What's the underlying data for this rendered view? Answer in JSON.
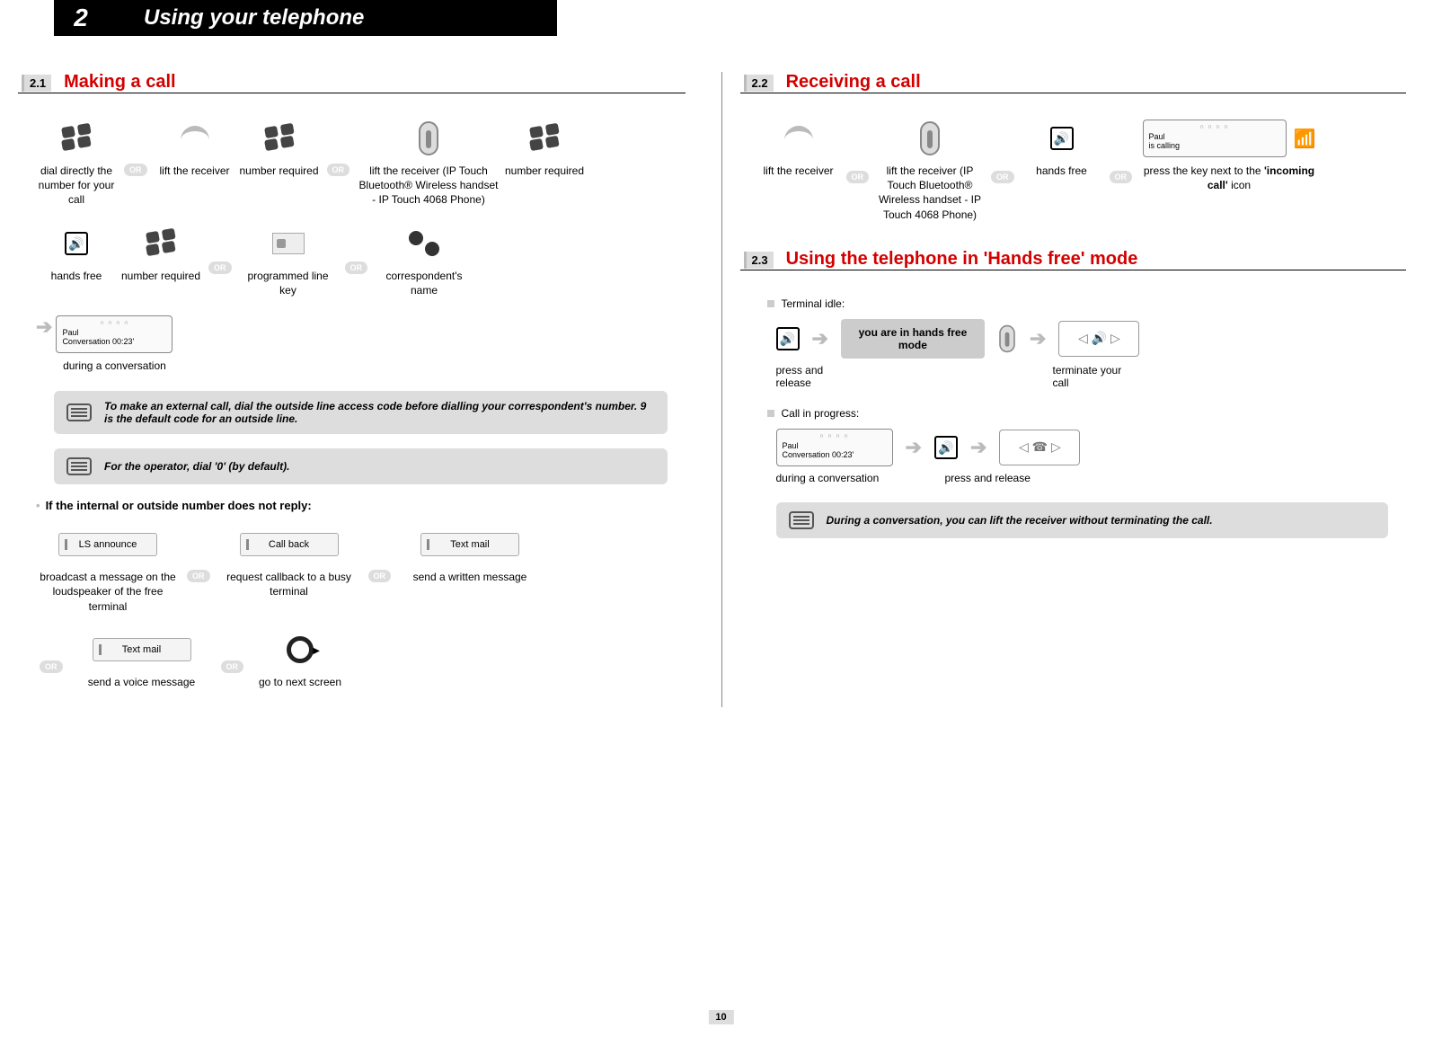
{
  "chapter": {
    "number": "2",
    "title": "Using your telephone"
  },
  "page_number": "10",
  "or_label": "OR",
  "s21": {
    "num": "2.1",
    "title": "Making a call",
    "row1": {
      "dial_direct": "dial directly the number for your call",
      "lift_receiver": "lift the receiver",
      "number_required_1": "number required",
      "lift_bt": "lift the receiver (IP Touch Bluetooth® Wireless handset - IP Touch 4068 Phone)",
      "number_required_2": "number required"
    },
    "row2": {
      "hands_free": "hands free",
      "number_required": "number required",
      "prog_line": "programmed line key",
      "corr_name": "correspondent's name"
    },
    "lcd": {
      "tabs": "∩ ∩ ∩ ∩",
      "line1": "Paul",
      "line2": "Conversation  00:23'"
    },
    "lcd_caption": "during a conversation",
    "note1": "To make an external call, dial the outside line access code before dialling your correspondent's number. 9 is the default code for an outside line.",
    "note2": "For the operator, dial '0' (by default).",
    "no_reply_heading": "If the internal or outside number does not reply:",
    "softkeys": {
      "ls_announce": "LS announce",
      "ls_announce_cap": "broadcast a message on the loudspeaker of the free terminal",
      "call_back": "Call back",
      "call_back_cap": "request callback to a busy terminal",
      "text_mail": "Text mail",
      "text_mail_cap": "send a written message",
      "text_mail2": "Text mail",
      "voice_cap": "send a voice message",
      "next_cap": "go to next screen"
    }
  },
  "s22": {
    "num": "2.2",
    "title": "Receiving a call",
    "lift_receiver": "lift the receiver",
    "lift_bt": "lift the receiver (IP Touch Bluetooth® Wireless handset - IP Touch 4068 Phone)",
    "hands_free": "hands free",
    "lcd": {
      "line1": "Paul",
      "line2": "is calling"
    },
    "press_key_pre": "press the key next to the",
    "press_key_bold": "'incoming call'",
    "press_key_post": "icon"
  },
  "s23": {
    "num": "2.3",
    "title": "Using the telephone in 'Hands free' mode",
    "idle_label": "Terminal idle:",
    "press_release": "press and release",
    "hf_status": "you are in hands free mode",
    "terminate": "terminate your call",
    "progress_label": "Call in progress:",
    "lcd": {
      "line1": "Paul",
      "line2": "Conversation  00:23'"
    },
    "during_conv": "during a conversation",
    "press_release2": "press and release",
    "note": "During a conversation, you can lift the receiver without terminating the call."
  }
}
